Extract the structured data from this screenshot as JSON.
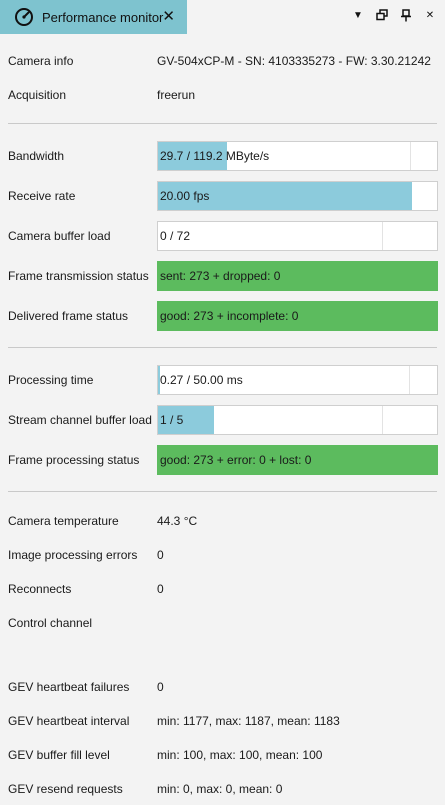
{
  "tab": {
    "title": "Performance monitor",
    "icon": "gauge-icon"
  },
  "colors": {
    "tab": "#7ec3cf",
    "bar_fill": "#8ccbdc",
    "status_ok": "#5cbb5e"
  },
  "info": {
    "camera_info_label": "Camera info",
    "camera_info_value": "GV-504xCP-M - SN: 4103335273 - FW:  3.30.21242",
    "acquisition_label": "Acquisition",
    "acquisition_value": "freerun"
  },
  "transfer": {
    "bandwidth_label": "Bandwidth",
    "bandwidth_value": "29.7 / 119.2 MByte/s",
    "bandwidth_fraction": 0.249,
    "receive_rate_label": "Receive rate",
    "receive_rate_value": "20.00 fps",
    "receive_rate_fraction": 0.909,
    "camera_buffer_label": "Camera buffer load",
    "camera_buffer_value": "0 / 72",
    "camera_buffer_fraction": 0.0,
    "frame_tx_label": "Frame transmission status",
    "frame_tx_value": "sent: 273 + dropped: 0",
    "delivered_label": "Delivered frame status",
    "delivered_value": "good: 273 + incomplete: 0"
  },
  "processing": {
    "processing_time_label": "Processing time",
    "processing_time_value": "0.27 / 50.00 ms",
    "processing_time_fraction": 0.0054,
    "stream_buffer_label": "Stream channel buffer load",
    "stream_buffer_value": "1 / 5",
    "stream_buffer_fraction": 0.2,
    "frame_processing_label": "Frame processing status",
    "frame_processing_value": "good: 273 + error: 0 + lost: 0"
  },
  "stats": {
    "temperature_label": "Camera temperature",
    "temperature_value": "44.3 °C",
    "img_errors_label": "Image processing errors",
    "img_errors_value": "0",
    "reconnects_label": "Reconnects",
    "reconnects_value": "0",
    "control_channel_label": "Control channel",
    "hb_failures_label": "GEV heartbeat failures",
    "hb_failures_value": "0",
    "hb_interval_label": "GEV heartbeat interval",
    "hb_interval_value": "min: 1177, max: 1187, mean: 1183",
    "buffer_fill_label": "GEV buffer fill level",
    "buffer_fill_value": "min: 100, max: 100, mean: 100",
    "resend_label": "GEV resend requests",
    "resend_value": "min: 0, max: 0, mean: 0"
  }
}
